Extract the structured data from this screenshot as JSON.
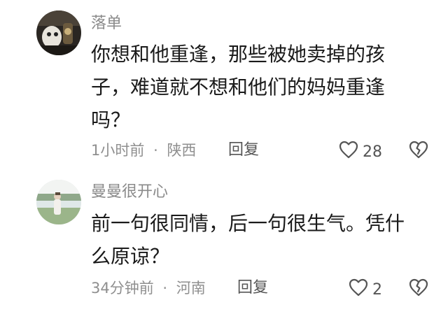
{
  "comments": [
    {
      "username": "落单",
      "text": "你想和他重逢，那些被她卖掉的孩子，难道就不想和他们的妈妈重逢吗？",
      "time": "1小时前",
      "sep": "·",
      "location": "陕西",
      "reply_label": "回复",
      "likes": "28"
    },
    {
      "username": "曼曼很开心",
      "text": "前一句很同情，后一句很生气。凭什么原谅？",
      "time": "34分钟前",
      "sep": "·",
      "location": "河南",
      "reply_label": "回复",
      "likes": "2"
    }
  ]
}
